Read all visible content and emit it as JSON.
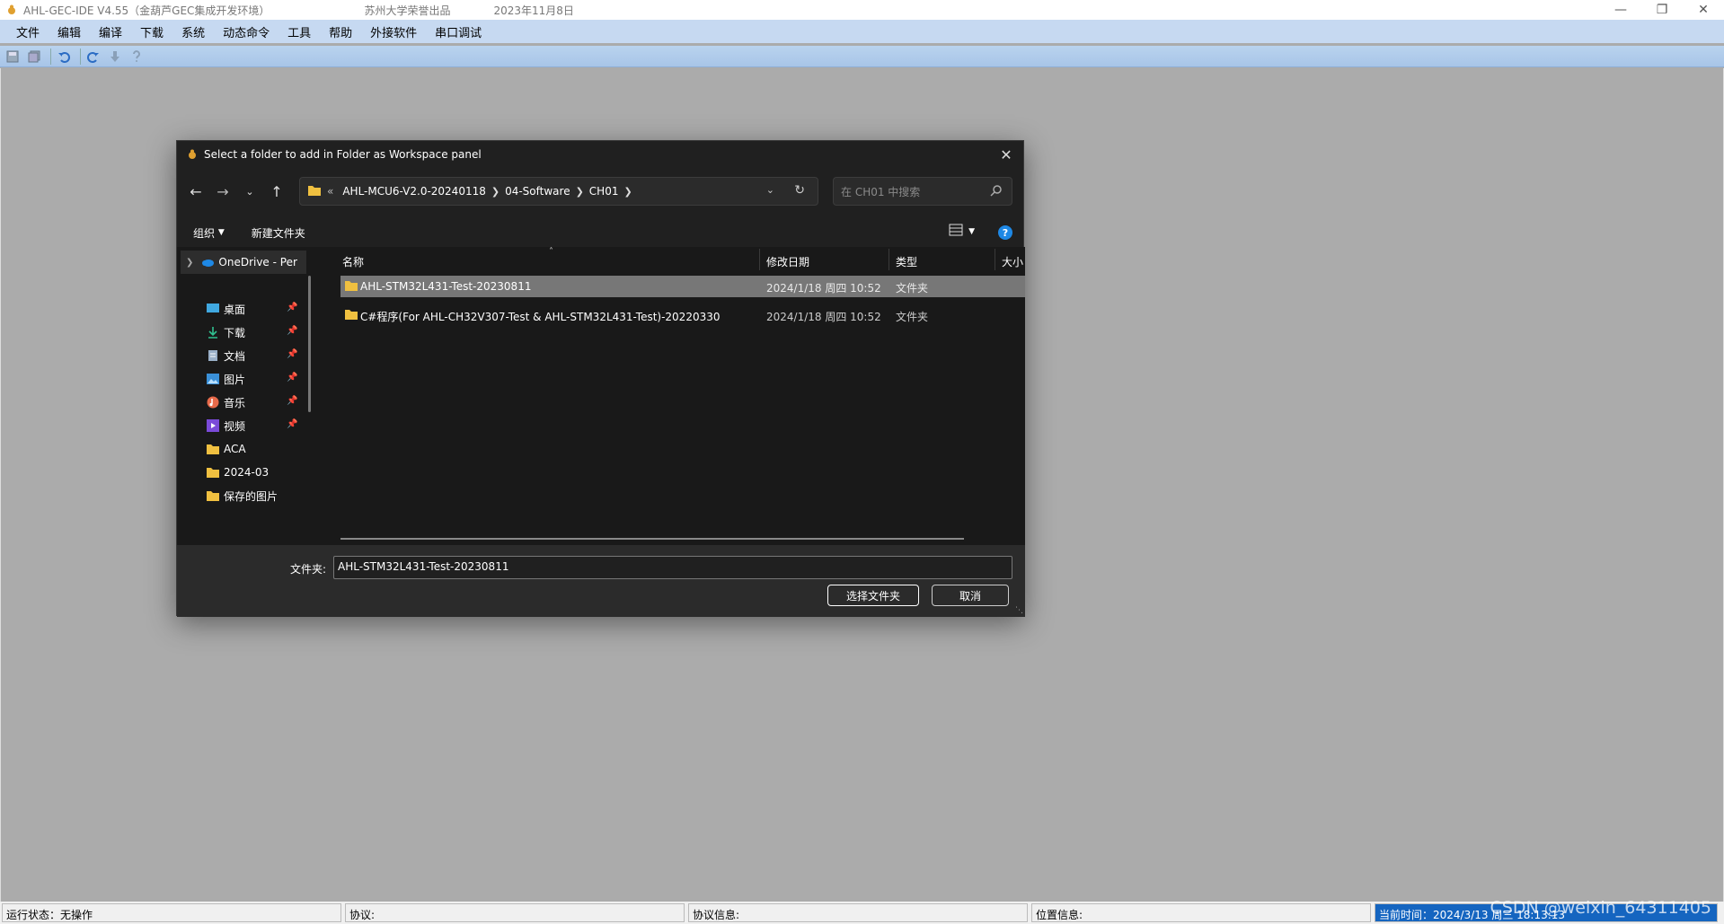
{
  "app": {
    "title": "AHL-GEC-IDE V4.55（金葫芦GEC集成开发环境）",
    "subtitle": "苏州大学荣誉出品",
    "date": "2023年11月8日"
  },
  "menu": [
    "文件",
    "编辑",
    "编译",
    "下载",
    "系统",
    "动态命令",
    "工具",
    "帮助",
    "外接软件",
    "串口调试"
  ],
  "dialog": {
    "title": "Select a folder to add in Folder as Workspace panel",
    "breadcrumb_lead": "«",
    "breadcrumbs": [
      "AHL-MCU6-V2.0-20240118",
      "04-Software",
      "CH01"
    ],
    "search_placeholder": "在 CH01 中搜索",
    "organize": "组织",
    "new_folder": "新建文件夹",
    "nav": {
      "onedrive": "OneDrive - Per",
      "items": [
        "桌面",
        "下载",
        "文档",
        "图片",
        "音乐",
        "视频",
        "ACA",
        "2024-03",
        "保存的图片"
      ]
    },
    "columns": {
      "name": "名称",
      "date": "修改日期",
      "type": "类型",
      "size": "大小"
    },
    "files": [
      {
        "name": "AHL-STM32L431-Test-20230811",
        "date": "2024/1/18 周四 10:52",
        "type": "文件夹"
      },
      {
        "name": "C#程序(For AHL-CH32V307-Test & AHL-STM32L431-Test)-20220330",
        "date": "2024/1/18 周四 10:52",
        "type": "文件夹"
      }
    ],
    "folder_label": "文件夹:",
    "folder_value": "AHL-STM32L431-Test-20230811",
    "select_button": "选择文件夹",
    "cancel_button": "取消"
  },
  "status": {
    "run_state": "运行状态：无操作",
    "protocol": "协议:",
    "protocol_info": "协议信息:",
    "position_info": "位置信息:",
    "current_time": "当前时间：2024/3/13 周三 18:13:13"
  },
  "watermark": "CSDN @weixin_64311405",
  "colors": {
    "menubar": "#c6d9f1",
    "dialog_bg": "#202020",
    "selection": "#777777",
    "status_time_bg": "#1565c0",
    "accent": "#1e88e5"
  }
}
